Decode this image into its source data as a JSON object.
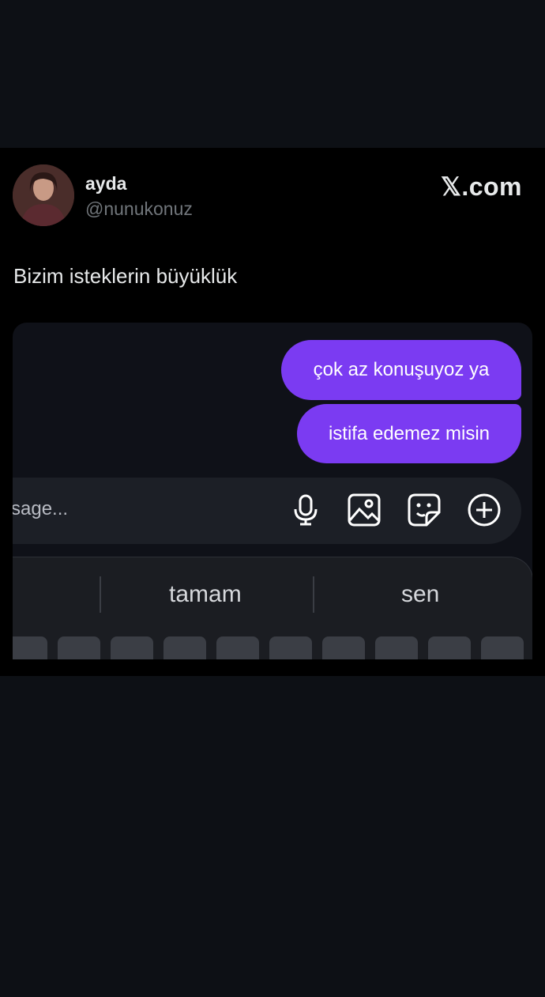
{
  "tweet": {
    "author_name": "ayda",
    "author_handle": "@nunukonuz",
    "brand": "𝕏.com",
    "text": "Bizim isteklerin büyüklük"
  },
  "chat": {
    "messages": [
      {
        "text": "çok az konuşuyoz ya",
        "direction": "outgoing"
      },
      {
        "text": "istifa edemez misin",
        "direction": "outgoing"
      }
    ],
    "composer_placeholder": "sage...",
    "composer_icons": [
      "microphone-icon",
      "image-icon",
      "sticker-icon",
      "plus-circle-icon"
    ]
  },
  "keyboard": {
    "suggestions": [
      "",
      "tamam",
      "sen"
    ]
  },
  "colors": {
    "background": "#0d1015",
    "card": "#000000",
    "bubble": "#7b3bf2",
    "composer": "#1c1f26",
    "keyboard": "#1b1d22"
  }
}
